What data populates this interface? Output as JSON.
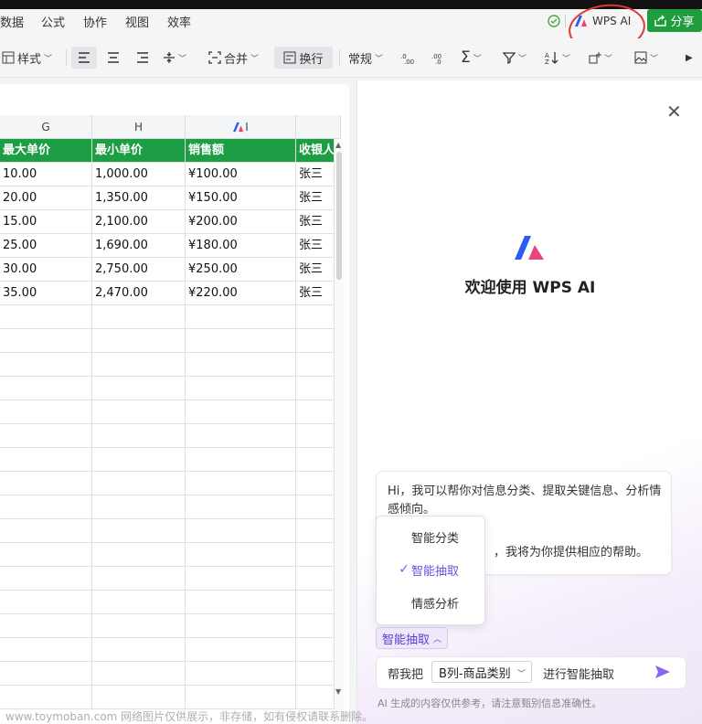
{
  "menu": [
    "数据",
    "公式",
    "协作",
    "视图",
    "效率"
  ],
  "header": {
    "wps_ai_label": "WPS AI",
    "share_label": "分享"
  },
  "toolbar": {
    "style_label": "样式",
    "merge_label": "合并",
    "wrap_label": "换行",
    "format_label": "常规"
  },
  "sheet": {
    "columns": [
      "G",
      "H",
      "I"
    ],
    "headers": [
      "最大单价",
      "最小单价",
      "销售额",
      "收银人"
    ],
    "rows": [
      [
        "10.00",
        "1,000.00",
        "¥100.00",
        "张三"
      ],
      [
        "20.00",
        "1,350.00",
        "¥150.00",
        "张三"
      ],
      [
        "15.00",
        "2,100.00",
        "¥200.00",
        "张三"
      ],
      [
        "25.00",
        "1,690.00",
        "¥180.00",
        "张三"
      ],
      [
        "30.00",
        "2,750.00",
        "¥250.00",
        "张三"
      ],
      [
        "35.00",
        "2,470.00",
        "¥220.00",
        "张三"
      ]
    ]
  },
  "panel": {
    "welcome": "欢迎使用 WPS AI",
    "greeting_1": "Hi，我可以帮你对信息分类、提取关键信息、分析情感倾向。",
    "greeting_2": "，我将为你提供相应的帮助。",
    "menu_options": [
      "智能分类",
      "智能抽取",
      "情感分析"
    ],
    "selected_mode": "智能抽取",
    "prompt_prefix": "帮我把",
    "column_select": "B列-商品类别",
    "prompt_suffix": "进行智能抽取",
    "disclaimer": "AI 生成的内容仅供参考，请注意甄别信息准确性。"
  },
  "watermark": "www.toymoban.com 网络图片仅供展示，非存储，如有侵权请联系删除。",
  "colors": {
    "green_header": "#1e9e44",
    "accent_purple": "#6a4fe0",
    "share_green": "#1f9d3f"
  }
}
